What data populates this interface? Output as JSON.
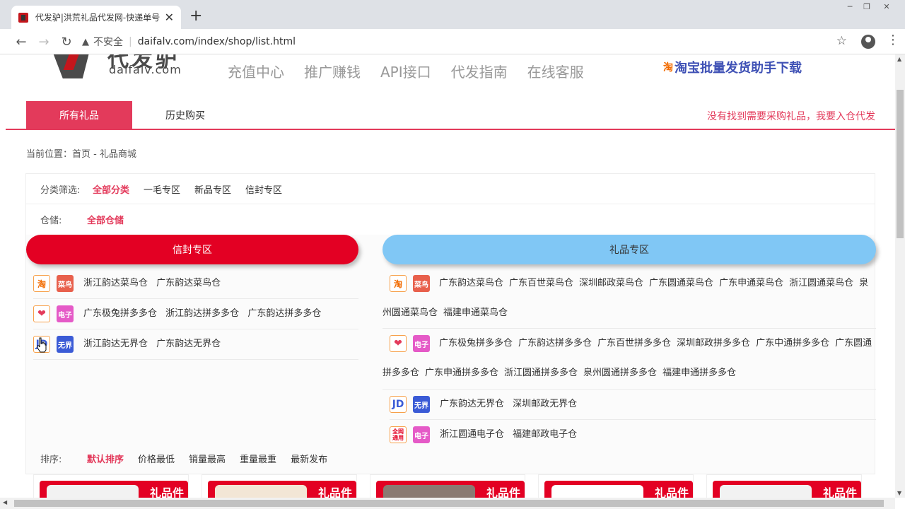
{
  "browser": {
    "tab_title": "代发驴|洪荒礼品代发网-快递单号",
    "insecure_label": "不安全",
    "url": "daifalv.com/index/shop/list.html"
  },
  "header": {
    "logo_cn": "代发驴",
    "logo_en": "daifalv.com",
    "nav": [
      "充值中心",
      "推广赚钱",
      "API接口",
      "代发指南",
      "在线客服"
    ],
    "download_badge": "淘",
    "download_label": "淘宝批量发货助手下载"
  },
  "subnav": {
    "tabs": [
      "所有礼品",
      "历史购买"
    ],
    "request_link": "没有找到需要采购礼品，我要入仓代发"
  },
  "breadcrumb": "当前位置：首页 - 礼品商城",
  "filters": {
    "category_label": "分类筛选:",
    "categories": [
      "全部分类",
      "一毛专区",
      "新品专区",
      "信封专区"
    ],
    "storage_label": "仓储:",
    "storage": [
      "全部仓储"
    ]
  },
  "zones": {
    "envelope": "信封专区",
    "gift": "礼品专区"
  },
  "icons": {
    "taobao": "淘",
    "cainiao": "菜鸟",
    "pdd": "❤",
    "dianzi": "电子",
    "jd": "JD",
    "wujie": "无界",
    "quanwang": "全网通用"
  },
  "envelope_rows": [
    {
      "icons": [
        "taobao",
        "cainiao"
      ],
      "warehouses": [
        "浙江韵达菜鸟仓",
        "广东韵达菜鸟仓"
      ]
    },
    {
      "icons": [
        "pdd",
        "dianzi"
      ],
      "warehouses": [
        "广东极兔拼多多仓",
        "浙江韵达拼多多仓",
        "广东韵达拼多多仓"
      ]
    },
    {
      "icons": [
        "jd",
        "wujie"
      ],
      "warehouses": [
        "浙江韵达无界仓",
        "广东韵达无界仓"
      ]
    }
  ],
  "gift_rows": [
    {
      "icons": [
        "taobao",
        "cainiao"
      ],
      "warehouses": [
        "广东韵达菜鸟仓",
        "广东百世菜鸟仓",
        "深圳邮政菜鸟仓",
        "广东圆通菜鸟仓",
        "广东申通菜鸟仓",
        "浙江圆通菜鸟仓",
        "泉州圆通菜鸟仓",
        "福建申通菜鸟仓"
      ]
    },
    {
      "icons": [
        "pdd",
        "dianzi"
      ],
      "warehouses": [
        "广东极兔拼多多仓",
        "广东韵达拼多多仓",
        "广东百世拼多多仓",
        "深圳邮政拼多多仓",
        "广东中通拼多多仓",
        "广东圆通拼多多仓",
        "广东申通拼多多仓",
        "浙江圆通拼多多仓",
        "泉州圆通拼多多仓",
        "福建申通拼多多仓"
      ]
    },
    {
      "icons": [
        "jd",
        "wujie"
      ],
      "warehouses": [
        "广东韵达无界仓",
        "深圳邮政无界仓"
      ]
    },
    {
      "icons": [
        "quanwang",
        "dianzi"
      ],
      "warehouses": [
        "浙江圆通电子仓",
        "福建邮政电子仓"
      ]
    }
  ],
  "sort": {
    "label": "排序:",
    "options": [
      "默认排序",
      "价格最低",
      "销量最高",
      "重量最重",
      "最新发布"
    ]
  },
  "product_tag": "礼品件",
  "colors": {
    "accent": "#e33a5b",
    "envelope_zone": "#e30023",
    "gift_zone": "#80c7f5",
    "download_link": "#3f51b5"
  }
}
